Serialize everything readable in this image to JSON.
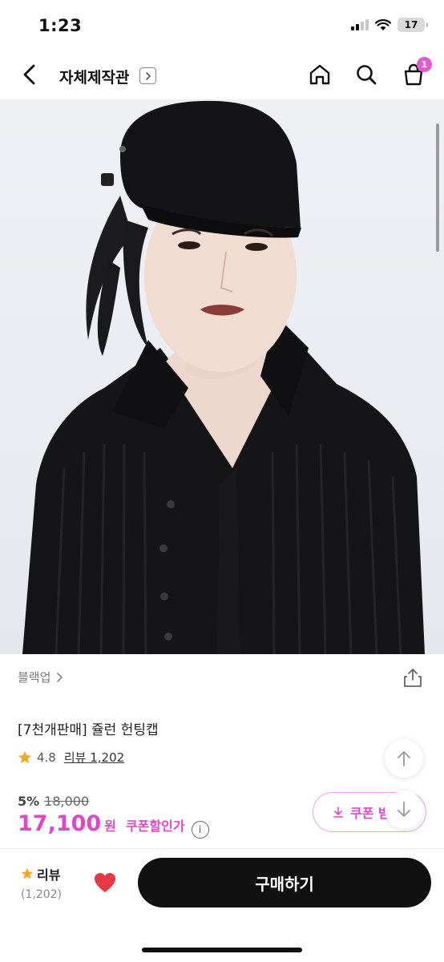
{
  "status": {
    "time": "1:23",
    "battery": "17"
  },
  "header": {
    "store_name": "자체제작관",
    "cart_count": "1"
  },
  "product": {
    "category": "블랙업",
    "title": "[7천개판매] 쥴런 헌팅캡",
    "rating": "4.8",
    "review_label": "리뷰 1,202",
    "discount_rate": "5%",
    "original_price": "18,000",
    "sale_price": "17,100",
    "currency": "원",
    "coupon_price_label": "쿠폰할인가",
    "coupon_button_label": "쿠폰 받"
  },
  "bottom": {
    "review_tab_label": "리뷰",
    "review_count": "(1,202)",
    "buy_label": "구매하기"
  },
  "colors": {
    "accent": "#e246c8",
    "dark": "#111111",
    "star": "#f5a623",
    "heart": "#e53945"
  }
}
